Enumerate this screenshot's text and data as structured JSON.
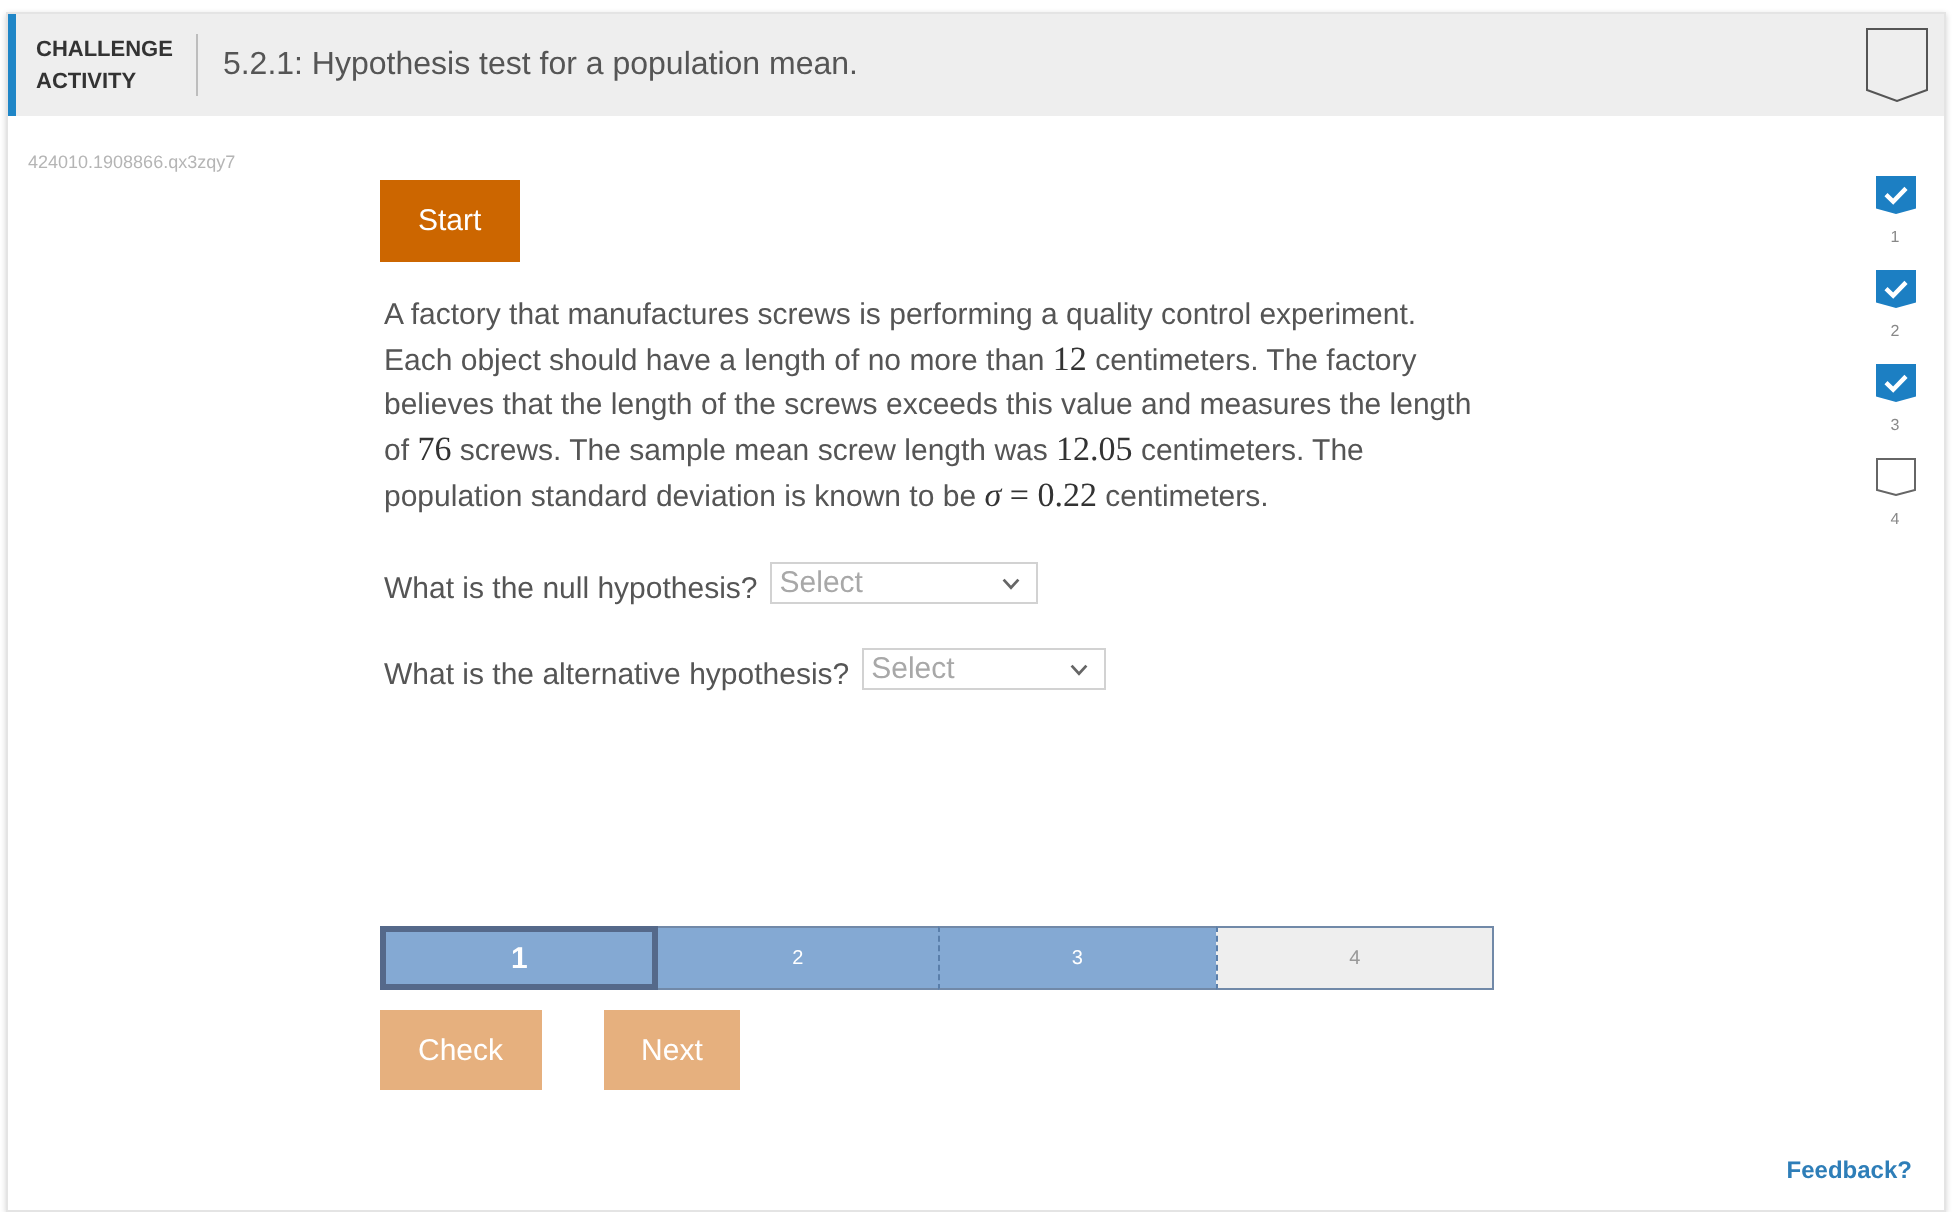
{
  "header": {
    "label": "CHALLENGE ACTIVITY",
    "title": "5.2.1: Hypothesis test for a population mean.",
    "completed": false
  },
  "activity_id": "424010.1908866.qx3zqy7",
  "start_button": {
    "label": "Start"
  },
  "problem": {
    "segments": [
      {
        "kind": "text",
        "text": "A factory that manufactures screws is performing a quality control experiment. Each object should have a length of no more than "
      },
      {
        "kind": "math",
        "text": "12"
      },
      {
        "kind": "text",
        "text": " centimeters. The factory believes that the length of the screws exceeds this value and measures the length of "
      },
      {
        "kind": "math",
        "text": "76"
      },
      {
        "kind": "text",
        "text": " screws. The sample mean screw length was "
      },
      {
        "kind": "math",
        "text": "12.05"
      },
      {
        "kind": "text",
        "text": " centimeters. The population standard deviation is known to be "
      },
      {
        "kind": "math",
        "text": "*σ* = 0.22"
      },
      {
        "kind": "text",
        "text": " centimeters."
      }
    ]
  },
  "questions": [
    {
      "prompt": "What is the null hypothesis?",
      "dropdown": {
        "placeholder": "Select"
      }
    },
    {
      "prompt": "What is the alternative hypothesis?",
      "dropdown": {
        "placeholder": "Select"
      }
    }
  ],
  "levels": [
    {
      "label": "1",
      "completed": true,
      "selected": true
    },
    {
      "label": "2",
      "completed": true,
      "selected": false
    },
    {
      "label": "3",
      "completed": true,
      "selected": false
    },
    {
      "label": "4",
      "completed": false,
      "selected": false
    }
  ],
  "actions": [
    {
      "label": "Check",
      "disabled": true
    },
    {
      "label": "Next",
      "disabled": true
    }
  ],
  "level_checklist": [
    {
      "label": "1",
      "completed": true
    },
    {
      "label": "2",
      "completed": true
    },
    {
      "label": "3",
      "completed": true
    },
    {
      "label": "4",
      "completed": false
    }
  ],
  "feedback_link": "Feedback?"
}
